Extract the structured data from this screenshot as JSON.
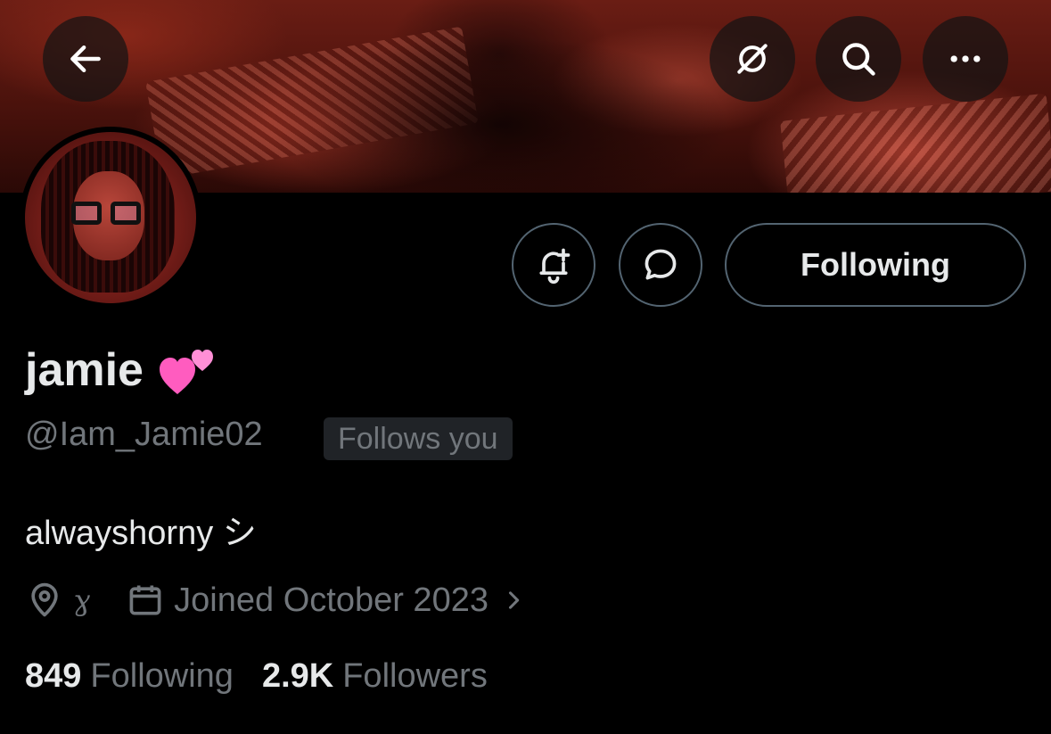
{
  "profile": {
    "name": "jamie",
    "name_emoji": "heart-icon",
    "handle": "@Iam_Jamie02",
    "follows_you": "Follows you",
    "bio": "alwayshorny シ",
    "location": "ɣ",
    "joined": "Joined October 2023"
  },
  "actions": {
    "following_label": "Following"
  },
  "stats": {
    "following_count": "849",
    "following_label": "Following",
    "followers_count": "2.9K",
    "followers_label": "Followers"
  },
  "colors": {
    "background": "#000000",
    "text_primary": "#e7e9ea",
    "text_secondary": "#71767b",
    "border": "#536471",
    "heart": "#ff6fc8"
  }
}
